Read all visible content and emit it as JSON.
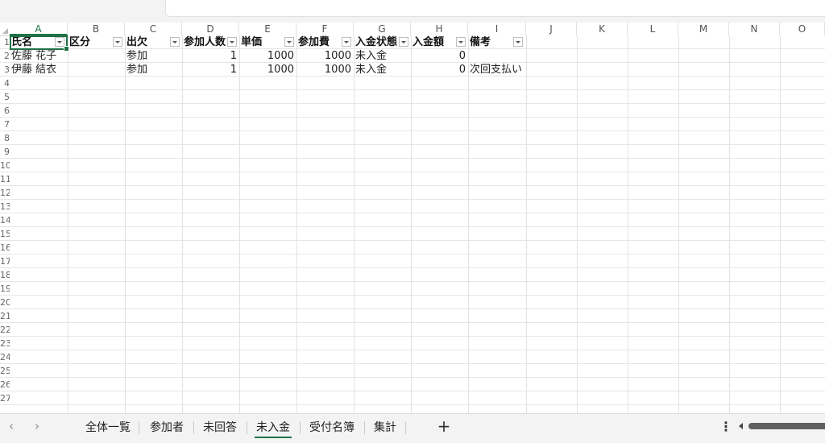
{
  "columns": [
    "A",
    "B",
    "C",
    "D",
    "E",
    "F",
    "G",
    "H",
    "I",
    "J",
    "K",
    "L",
    "M",
    "N",
    "O"
  ],
  "row_numbers": [
    "1",
    "2",
    "3",
    "4",
    "5",
    "6",
    "7",
    "8",
    "9",
    "10",
    "11",
    "12",
    "13",
    "14",
    "15",
    "16",
    "17",
    "18",
    "19",
    "20",
    "21",
    "22",
    "23",
    "24",
    "25",
    "26",
    "27"
  ],
  "table": {
    "headers": [
      "氏名",
      "区分",
      "出欠",
      "参加人数",
      "単価",
      "参加費",
      "入金状態",
      "入金額",
      "備考"
    ],
    "rows": [
      [
        "佐藤 花子",
        "",
        "参加",
        "1",
        "1000",
        "1000",
        "未入金",
        "0",
        ""
      ],
      [
        "伊藤 結衣",
        "",
        "参加",
        "1",
        "1000",
        "1000",
        "未入金",
        "0",
        "次回支払い"
      ]
    ]
  },
  "sheet_tabs": [
    "全体一覧",
    "参加者",
    "未回答",
    "未入金",
    "受付名簿",
    "集計"
  ],
  "active_tab": "未入金",
  "add_sheet_label": "+",
  "more_label": "⋮",
  "nav": {
    "prev": "‹",
    "next": "›"
  },
  "colors": {
    "accent": "#1f7246",
    "grid": "#e6e6e6",
    "tabbar": "#f3f3f3"
  }
}
